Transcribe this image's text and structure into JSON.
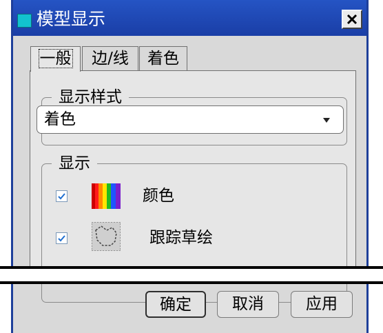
{
  "window": {
    "title": "模型显示",
    "close_icon": "close-icon"
  },
  "tabs": [
    {
      "label": "一般",
      "active": true
    },
    {
      "label": "边/线",
      "active": false
    },
    {
      "label": "着色",
      "active": false
    }
  ],
  "display_style": {
    "legend": "显示样式",
    "selected": "着色"
  },
  "display": {
    "legend": "显示",
    "items": [
      {
        "label": "颜色",
        "checked": true,
        "icon": "color-spectrum-icon"
      },
      {
        "label": "跟踪草绘",
        "checked": true,
        "icon": "trace-sketch-icon"
      }
    ]
  },
  "buttons": {
    "ok": "确定",
    "cancel": "取消",
    "apply": "应用"
  },
  "colors": {
    "title_bar": "#1f48b8",
    "dialog_bg": "#d9d9d9"
  }
}
